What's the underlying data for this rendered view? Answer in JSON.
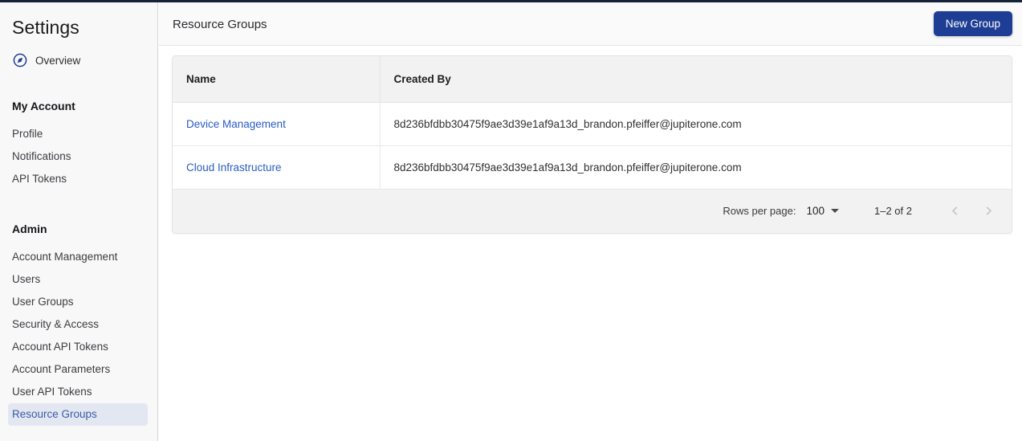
{
  "window": {
    "accent_navy": "#152238",
    "accent_blue": "#1d3e94",
    "link_blue": "#2b5bc4",
    "selected_bg": "#e3e7f1"
  },
  "sidebar": {
    "title": "Settings",
    "overview": {
      "label": "Overview",
      "icon": "compass-icon"
    },
    "sections": [
      {
        "heading": "My Account",
        "items": [
          {
            "label": "Profile",
            "selected": false
          },
          {
            "label": "Notifications",
            "selected": false
          },
          {
            "label": "API Tokens",
            "selected": false
          }
        ]
      },
      {
        "heading": "Admin",
        "items": [
          {
            "label": "Account Management",
            "selected": false
          },
          {
            "label": "Users",
            "selected": false
          },
          {
            "label": "User Groups",
            "selected": false
          },
          {
            "label": "Security & Access",
            "selected": false
          },
          {
            "label": "Account API Tokens",
            "selected": false
          },
          {
            "label": "Account Parameters",
            "selected": false
          },
          {
            "label": "User API Tokens",
            "selected": false
          },
          {
            "label": "Resource Groups",
            "selected": true
          }
        ]
      }
    ]
  },
  "header": {
    "title": "Resource Groups",
    "new_group_label": "New Group"
  },
  "table": {
    "columns": [
      {
        "key": "name",
        "label": "Name"
      },
      {
        "key": "created_by",
        "label": "Created By"
      }
    ],
    "rows": [
      {
        "name": "Device Management",
        "created_by": "8d236bfdbb30475f9ae3d39e1af9a13d_brandon.pfeiffer@jupiterone.com"
      },
      {
        "name": "Cloud Infrastructure",
        "created_by": "8d236bfdbb30475f9ae3d39e1af9a13d_brandon.pfeiffer@jupiterone.com"
      }
    ]
  },
  "pagination": {
    "rows_per_page_label": "Rows per page:",
    "rows_per_page_value": "100",
    "range_label": "1–2 of 2",
    "prev_icon": "chevron-left-icon",
    "next_icon": "chevron-right-icon"
  }
}
